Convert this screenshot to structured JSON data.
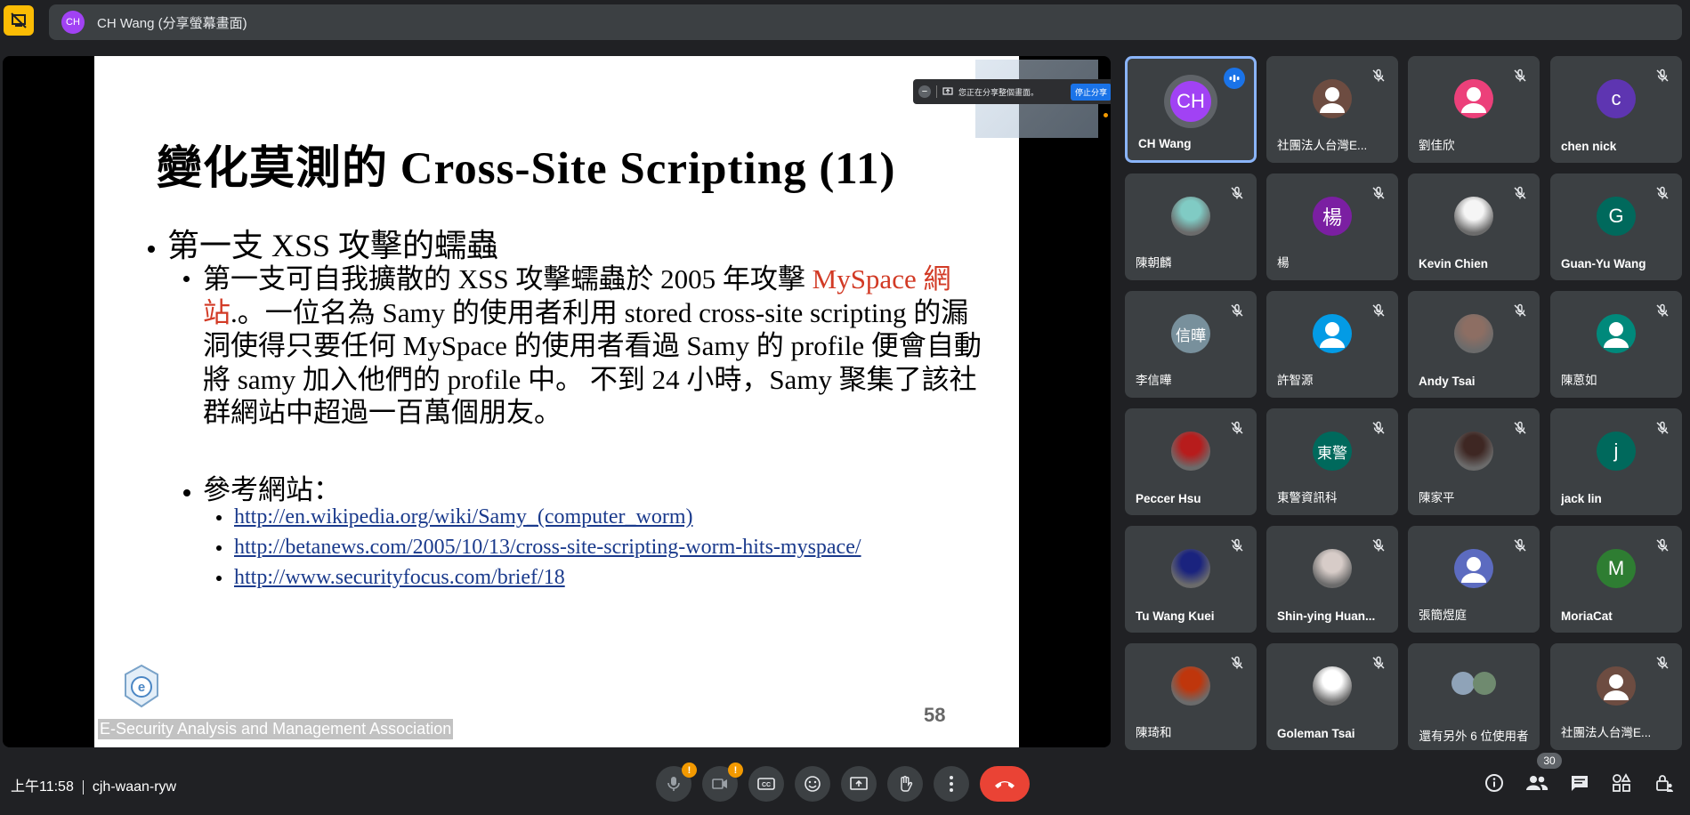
{
  "header": {
    "avatar_initials": "CH",
    "title": "CH Wang (分享螢幕畫面)"
  },
  "slide": {
    "title": "變化莫測的 Cross-Site Scripting (11)",
    "bullet1": "第一支 XSS 攻擊的蠕蟲",
    "para_part1": "第一支可自我擴散的 XSS 攻擊蠕蟲於 2005 年攻擊",
    "para_red": "MySpace 網站",
    "para_part2": ".。一位名為 Samy 的使用者利用 stored cross-site scripting 的漏洞使得只要任何 MySpace 的使用者看過 Samy 的 profile 便會自動將 samy 加入他們的 profile 中。 不到 24 小時，Samy 聚集了該社群網站中超過一百萬個朋友。",
    "bullet2": "參考網站：",
    "links": [
      "http://en.wikipedia.org/wiki/Samy_(computer_worm)",
      "http://betanews.com/2005/10/13/cross-site-scripting-worm-hits-myspace/",
      "http://www.securityfocus.com/brief/18"
    ],
    "org": "E-Security Analysis and Management Association",
    "page_number": "58"
  },
  "share_bar": {
    "status": "您正在分享整個畫面。",
    "stop_label": "停止分享"
  },
  "participants": [
    {
      "name": "CH Wang",
      "initials": "CH",
      "color": "#a142f4",
      "active": true
    },
    {
      "name": "社團法人台灣E...",
      "initials": "",
      "color": "#6d4c41",
      "generic": true
    },
    {
      "name": "劉佳欣",
      "initials": "",
      "color": "#ec407a",
      "generic": true
    },
    {
      "name": "chen nick",
      "initials": "c",
      "color": "#5e35b1"
    },
    {
      "name": "陳朝麟",
      "initials": "",
      "color": "#80cbc4",
      "photo": true
    },
    {
      "name": "楊",
      "initials": "楊",
      "color": "#7b1fa2"
    },
    {
      "name": "Kevin Chien",
      "initials": "",
      "color": "#f5f5f5",
      "photo": true
    },
    {
      "name": "Guan-Yu Wang",
      "initials": "G",
      "color": "#00695c"
    },
    {
      "name": "李信曄",
      "initials": "信曄",
      "color": "#78909c"
    },
    {
      "name": "許智源",
      "initials": "",
      "color": "#039be5",
      "generic": true
    },
    {
      "name": "Andy Tsai",
      "initials": "",
      "color": "#8d6e63",
      "photo": true
    },
    {
      "name": "陳蒽如",
      "initials": "",
      "color": "#00897b",
      "generic": true
    },
    {
      "name": "Peccer Hsu",
      "initials": "",
      "color": "#b71c1c",
      "photo": true
    },
    {
      "name": "東警資訊科",
      "initials": "東警",
      "color": "#00695c"
    },
    {
      "name": "陳家平",
      "initials": "",
      "color": "#3e2723",
      "photo": true
    },
    {
      "name": "jack lin",
      "initials": "j",
      "color": "#00695c"
    },
    {
      "name": "Tu Wang Kuei",
      "initials": "",
      "color": "#1a237e",
      "photo": true
    },
    {
      "name": "Shin-ying Huan...",
      "initials": "",
      "color": "#d7ccc8",
      "photo": true
    },
    {
      "name": "張簡煜庭",
      "initials": "",
      "color": "#5c6bc0",
      "generic": true
    },
    {
      "name": "MoriaCat",
      "initials": "M",
      "color": "#2e7d32"
    },
    {
      "name": "陳琦和",
      "initials": "",
      "color": "#bf360c",
      "photo": true
    },
    {
      "name": "Goleman Tsai",
      "initials": "",
      "color": "#ffffff",
      "photo": true
    },
    {
      "name": "",
      "more": "還有另外 6 位使用者"
    },
    {
      "name": "社團法人台灣E...",
      "initials": "",
      "color": "#6d4c41",
      "generic": true
    }
  ],
  "bottom": {
    "time": "上午11:58",
    "meeting_code": "cjh-waan-ryw",
    "mic_badge": "!",
    "cam_badge": "!",
    "participant_count": "30"
  },
  "colors": {
    "background": "#202124",
    "tile": "#3c4043",
    "accent": "#8ab4f8",
    "end_call": "#ea4335",
    "present_icon": "#fbbc04"
  }
}
